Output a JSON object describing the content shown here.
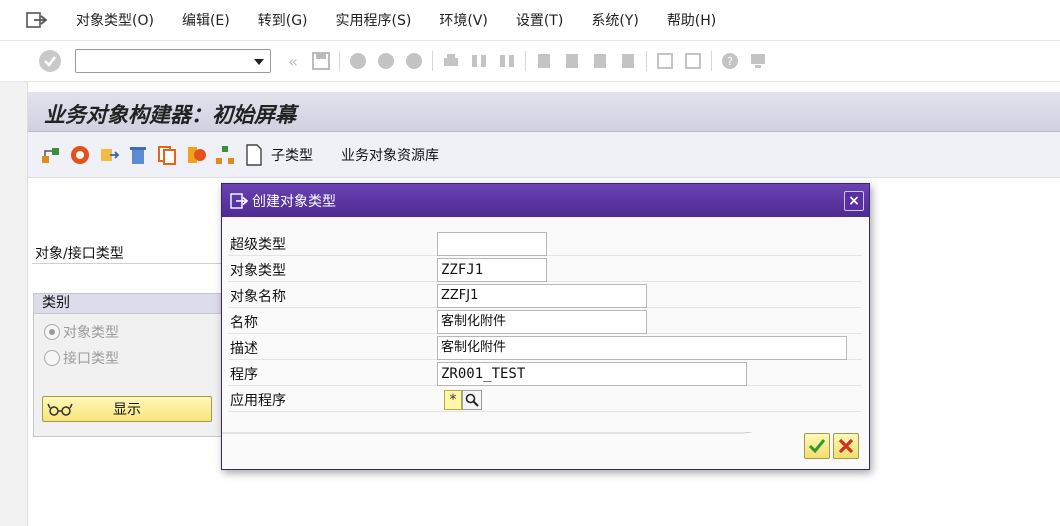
{
  "menubar": {
    "items": [
      "对象类型(O)",
      "编辑(E)",
      "转到(G)",
      "实用程序(S)",
      "环境(V)",
      "设置(T)",
      "系统(Y)",
      "帮助(H)"
    ]
  },
  "toolbar": {
    "command_value": ""
  },
  "page": {
    "title": "业务对象构建器：初始屏幕"
  },
  "app_toolbar": {
    "subtype_label": "子类型",
    "library_label": "业务对象资源库"
  },
  "main": {
    "object_interface_label": "对象/接口类型",
    "category": {
      "title": "类别",
      "options": [
        "对象类型",
        "接口类型"
      ],
      "selected": "对象类型"
    },
    "show_button": "显示"
  },
  "dialog": {
    "title": "创建对象类型",
    "fields": [
      {
        "label": "超级类型",
        "value": ""
      },
      {
        "label": "对象类型",
        "value": "ZZFJ1"
      },
      {
        "label": "对象名称",
        "value": "ZZFJ1"
      },
      {
        "label": "名称",
        "value": "客制化附件"
      },
      {
        "label": "描述",
        "value": "客制化附件"
      },
      {
        "label": "程序",
        "value": "ZR001_TEST"
      },
      {
        "label": "应用程序",
        "value": "*"
      }
    ]
  },
  "colors": {
    "dialog_title": "#5a35a6",
    "title_bar": "#d8d8e6",
    "button_yellow": "#f7e57a",
    "confirm_green": "#2f9a2f",
    "cancel_red": "#d2301c"
  },
  "icons": {
    "menu_exit": "exit-icon",
    "ok": "check-circle-icon",
    "dialog_confirm": "check-icon",
    "dialog_cancel": "cancel-icon",
    "search": "search-icon"
  }
}
